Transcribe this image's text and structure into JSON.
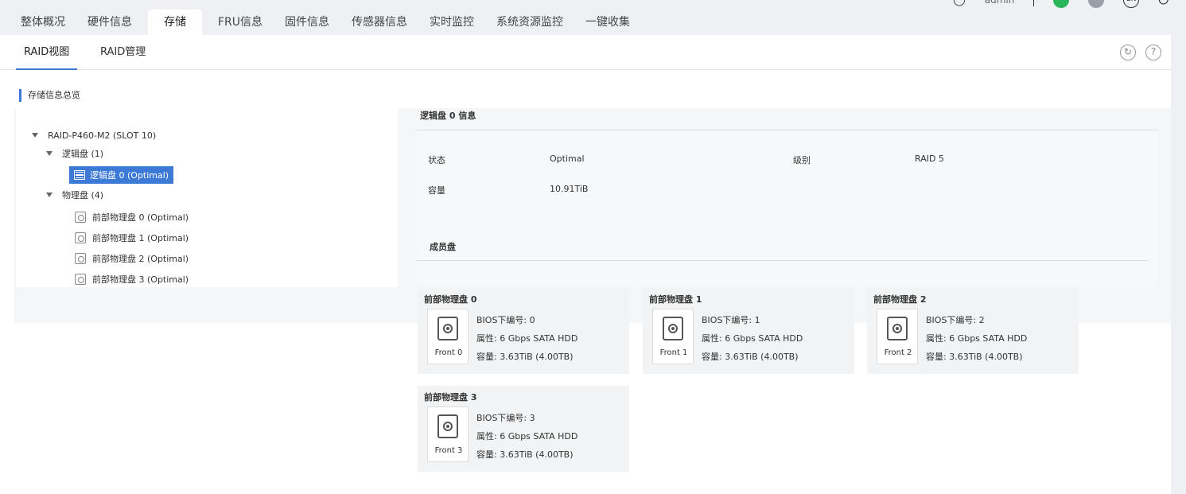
{
  "header": {
    "tabs": [
      {
        "label": "整体概况"
      },
      {
        "label": "硬件信息"
      },
      {
        "label": "存储"
      },
      {
        "label": "FRU信息"
      },
      {
        "label": "固件信息"
      },
      {
        "label": "传感器信息"
      },
      {
        "label": "实时监控"
      },
      {
        "label": "系统资源监控"
      },
      {
        "label": "一键收集"
      }
    ],
    "active_tab": "存储",
    "user": "admin",
    "lang": "EN"
  },
  "subtabs": [
    {
      "label": "RAID视图"
    },
    {
      "label": "RAID管理"
    }
  ],
  "section_title": "存储信息总览",
  "tree": {
    "controller": "RAID-P460-M2 (SLOT 10)",
    "logical_group": "逻辑盘 (1)",
    "logical_disks": [
      "逻辑盘 0 (Optimal)"
    ],
    "physical_group": "物理盘 (4)",
    "physical_disks": [
      "前部物理盘 0 (Optimal)",
      "前部物理盘 1 (Optimal)",
      "前部物理盘 2 (Optimal)",
      "前部物理盘 3 (Optimal)"
    ]
  },
  "info": {
    "title": "逻辑盘 0 信息",
    "status_label": "状态",
    "status_value": "Optimal",
    "level_label": "级别",
    "level_value": "RAID 5",
    "capacity_label": "容量",
    "capacity_value": "10.91TiB",
    "member_title": "成员盘"
  },
  "members": [
    {
      "title": "前部物理盘 0",
      "front": "Front 0",
      "bios": "BIOS下编号: 0",
      "attr": "属性: 6 Gbps SATA HDD",
      "cap": "容量: 3.63TiB (4.00TB)"
    },
    {
      "title": "前部物理盘 1",
      "front": "Front 1",
      "bios": "BIOS下编号: 1",
      "attr": "属性: 6 Gbps SATA HDD",
      "cap": "容量: 3.63TiB (4.00TB)"
    },
    {
      "title": "前部物理盘 2",
      "front": "Front 2",
      "bios": "BIOS下编号: 2",
      "attr": "属性: 6 Gbps SATA HDD",
      "cap": "容量: 3.63TiB (4.00TB)"
    },
    {
      "title": "前部物理盘 3",
      "front": "Front 3",
      "bios": "BIOS下编号: 3",
      "attr": "属性: 6 Gbps SATA HDD",
      "cap": "容量: 3.63TiB (4.00TB)"
    }
  ],
  "colors": {
    "accent": "#3d7ad6",
    "status_green": "#2bb55a"
  },
  "icons": [
    "user-icon",
    "green-status-icon",
    "grey-status-icon",
    "lang-icon",
    "power-icon",
    "refresh-icon",
    "help-icon",
    "logical-disk-icon",
    "physical-disk-icon",
    "hdd-icon"
  ]
}
